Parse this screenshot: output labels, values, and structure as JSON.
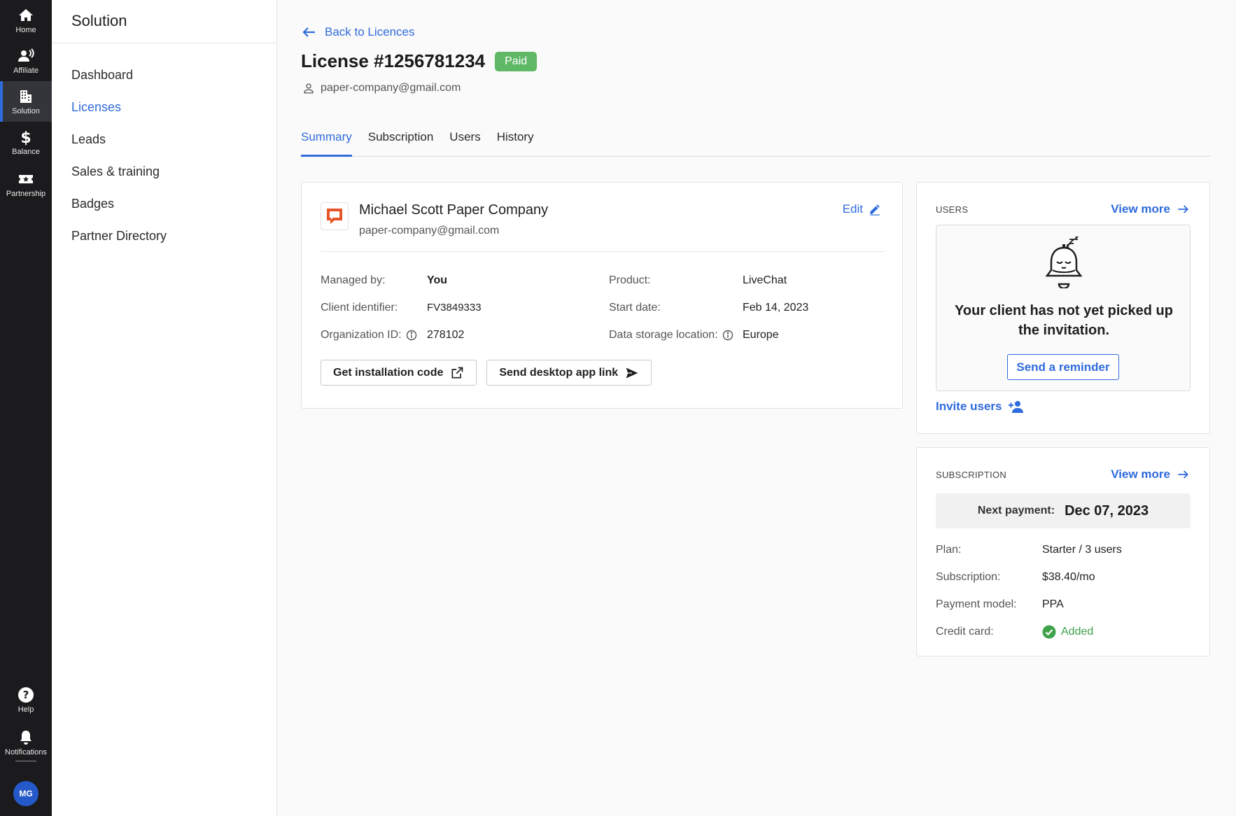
{
  "rail": {
    "items": [
      {
        "label": "Home",
        "icon": "home-icon"
      },
      {
        "label": "Affiliate",
        "icon": "affiliate-icon"
      },
      {
        "label": "Solution",
        "icon": "building-icon"
      },
      {
        "label": "Balance",
        "icon": "dollar-icon"
      },
      {
        "label": "Partnership",
        "icon": "ticket-icon"
      }
    ],
    "help": "Help",
    "notifications": "Notifications",
    "avatar": "MG"
  },
  "sidebar": {
    "title": "Solution",
    "items": [
      {
        "label": "Dashboard"
      },
      {
        "label": "Licenses"
      },
      {
        "label": "Leads"
      },
      {
        "label": "Sales & training"
      },
      {
        "label": "Badges"
      },
      {
        "label": "Partner Directory"
      }
    ],
    "active": "Licenses"
  },
  "header": {
    "back_label": "Back to Licences",
    "title": "License #1256781234",
    "status_badge": "Paid",
    "email": "paper-company@gmail.com"
  },
  "tabs": [
    {
      "label": "Summary"
    },
    {
      "label": "Subscription"
    },
    {
      "label": "Users"
    },
    {
      "label": "History"
    }
  ],
  "company": {
    "name": "Michael Scott Paper Company",
    "email": "paper-company@gmail.com",
    "edit_label": "Edit",
    "fields": {
      "managed_by_label": "Managed by:",
      "managed_by_value": "You",
      "client_id_label": "Client identifier:",
      "client_id_value": "FV3849333",
      "org_id_label": "Organization ID:",
      "org_id_value": "278102",
      "product_label": "Product:",
      "product_value": "LiveChat",
      "start_date_label": "Start date:",
      "start_date_value": "Feb 14, 2023",
      "storage_label": "Data storage location:",
      "storage_value": "Europe"
    },
    "buttons": {
      "install_code": "Get installation code",
      "desktop_link": "Send desktop app link"
    }
  },
  "users_panel": {
    "label": "USERS",
    "view_more": "View more",
    "empty_text": "Your client has not yet picked up the invitation.",
    "reminder_button": "Send a reminder",
    "invite_label": "Invite users"
  },
  "subscription_panel": {
    "label": "SUBSCRIPTION",
    "view_more": "View more",
    "next_payment_label": "Next payment:",
    "next_payment_value": "Dec 07, 2023",
    "rows": [
      {
        "label": "Plan:",
        "value": "Starter / 3 users"
      },
      {
        "label": "Subscription:",
        "value": "$38.40/mo"
      },
      {
        "label": "Payment model:",
        "value": "PPA"
      },
      {
        "label": "Credit card:",
        "value": "Added"
      }
    ]
  },
  "colors": {
    "accent": "#2f6bdc",
    "paid": "#5fb865",
    "added": "#3fa14a",
    "rail": "#1b1b1d"
  }
}
